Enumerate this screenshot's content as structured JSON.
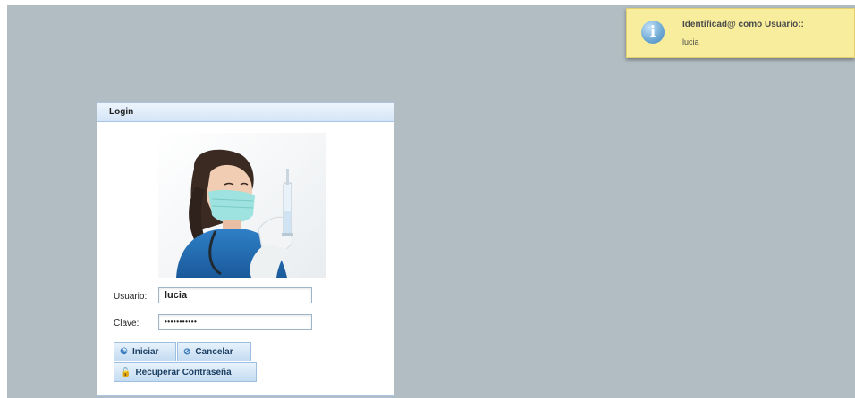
{
  "notification": {
    "icon": "info-icon",
    "title": "Identificad@ como Usuario::",
    "message": "lucia"
  },
  "login": {
    "title": "Login",
    "photo_icon": "nurse-photo",
    "user_label": "Usuario:",
    "user_value": "lucia",
    "password_label": "Clave:",
    "password_value": "•••••••••••",
    "login_button": "Iniciar",
    "login_icon": "user-icon",
    "cancel_button": "Cancelar",
    "cancel_icon": "cancel-icon",
    "recover_button": "Recuperar Contraseña",
    "recover_icon": "unlock-icon"
  },
  "colors": {
    "background": "#b1bdc2",
    "notification_bg": "#f8ed9c",
    "panel_header": "#d4e5f7",
    "button_text": "#1b3f63"
  }
}
